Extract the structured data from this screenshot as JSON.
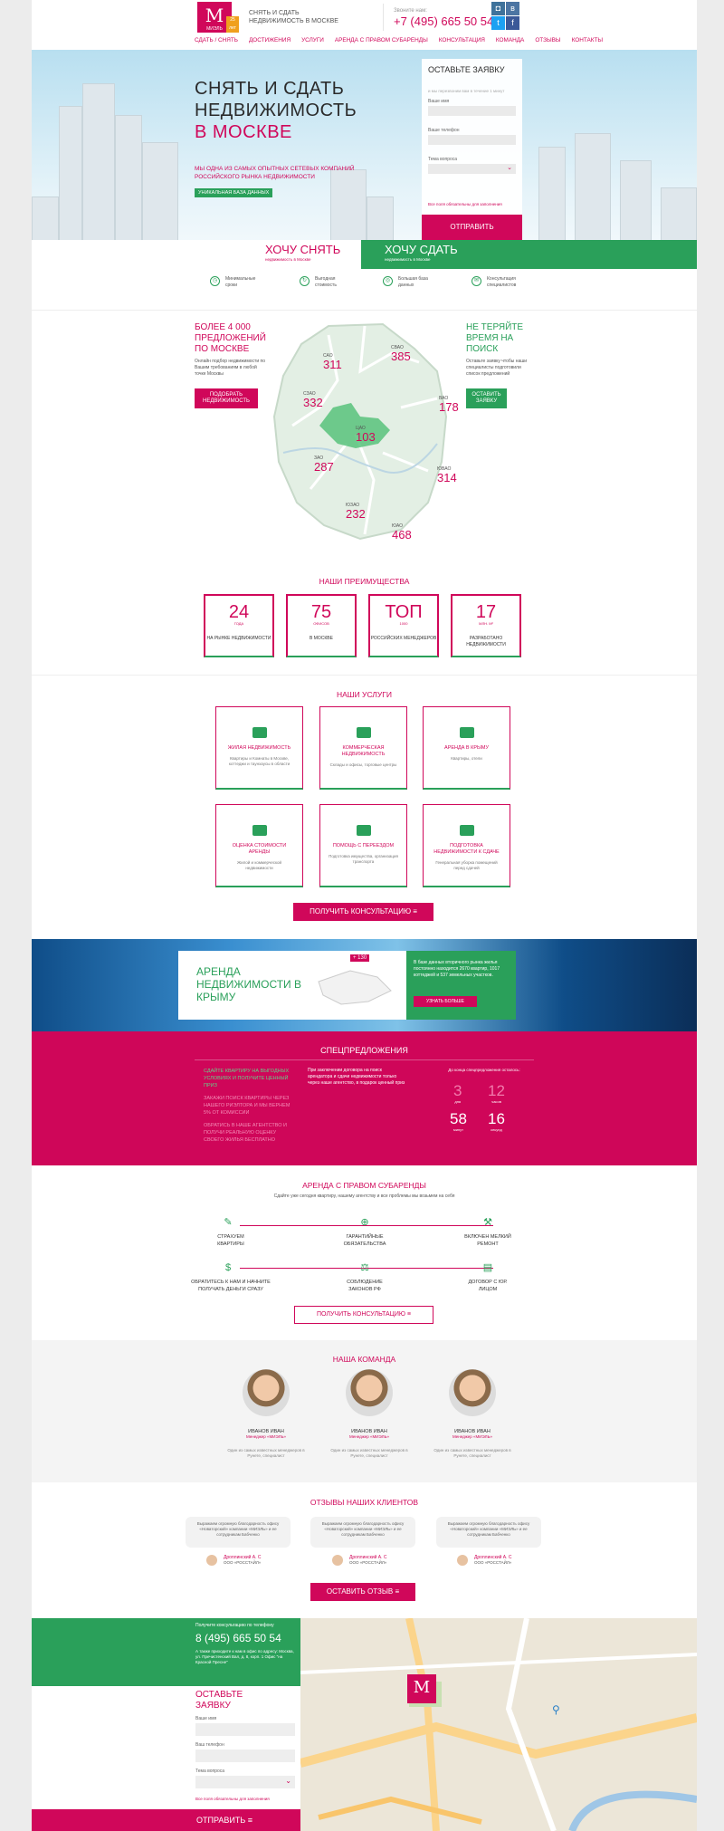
{
  "header": {
    "tagline": "СНЯТЬ И СДАТЬ НЕДВИЖИМОСТЬ В МОСКВЕ",
    "phone_label": "Звоните нам:",
    "phone": "+7 (495) 665 50 54",
    "logo_letter": "M",
    "logo_text": "МИЭЛЬ",
    "badge": "25 лет"
  },
  "nav": [
    "СДАТЬ / СНЯТЬ",
    "ДОСТИЖЕНИЯ",
    "УСЛУГИ",
    "АРЕНДА С ПРАВОМ СУБАРЕНДЫ",
    "КОНСУЛЬТАЦИЯ",
    "КОМАНДА",
    "ОТЗЫВЫ",
    "КОНТАКТЫ"
  ],
  "hero": {
    "title_1": "СНЯТЬ И СДАТЬ",
    "title_2": "НЕДВИЖИМОСТЬ",
    "title_3": "В МОСКВЕ",
    "sub": "МЫ ОДНА ИЗ САМЫХ ОПЫТНЫХ СЕТЕВЫХ КОМПАНИЙ РОССИЙСКОГО РЫНКА НЕДВИЖИМОСТИ",
    "badge": "УНИКАЛЬНАЯ БАЗА ДАННЫХ"
  },
  "form": {
    "title": "ОСТАВЬТЕ ЗАЯВКУ",
    "sub": "и мы перезвоним вам в течение 1 минут",
    "name": "Ваше имя",
    "phone": "Ваше телефон",
    "topic": "Тема вопроса",
    "note": "Все поля обязательны для заполнения",
    "button": "ОТПРАВИТЬ"
  },
  "tabs": {
    "rent": "ХОЧУ СНЯТЬ",
    "rent_sub": "недвижимость в Москве",
    "let": "ХОЧУ СДАТЬ",
    "let_sub": "недвижимость в Москве"
  },
  "features": [
    "Минимальные сроки",
    "Выгодная стоимость",
    "Большая база данных",
    "Консультация специалистов"
  ],
  "offers": {
    "title": "БОЛЕЕ 4 000 ПРЕДЛОЖЕНИЙ ПО МОСКВЕ",
    "text": "Онлайн подбор недвижимости по Вашим требованиям в любой точке Москвы",
    "button": "Подобрать НЕДВИЖИМОСТЬ"
  },
  "request": {
    "title": "НЕ ТЕРЯЙТЕ ВРЕМЯ НА ПОИСК",
    "text": "Оставьте заявку чтобы наши специалисты подготовили список предложений",
    "button": "Оставить ЗАЯВКУ"
  },
  "districts": [
    {
      "n": "САО",
      "v": "311"
    },
    {
      "n": "СВАО",
      "v": "385"
    },
    {
      "n": "СЗАО",
      "v": "332"
    },
    {
      "n": "ВАО",
      "v": "178"
    },
    {
      "n": "ЦАО",
      "v": "103"
    },
    {
      "n": "ЗАО",
      "v": "287"
    },
    {
      "n": "ЮВАО",
      "v": "314"
    },
    {
      "n": "ЮЗАО",
      "v": "232"
    },
    {
      "n": "ЮАО",
      "v": "468"
    }
  ],
  "advantages": {
    "title": "НАШИ ПРЕИМУЩЕСТВА",
    "items": [
      {
        "v": "24",
        "u": "ГОДА",
        "l": "НА РЫНКЕ НЕДВИЖИМОСТИ"
      },
      {
        "v": "75",
        "u": "ОФИСОВ",
        "l": "В МОСКВЕ"
      },
      {
        "v": "ТОП",
        "u": "1000",
        "l": "РОССИЙСКИХ МЕНЕДЖЕРОВ"
      },
      {
        "v": "17",
        "u": "МЛН. М²",
        "l": "РАЗРАБОТАНО НЕДВИЖИМОСТИ"
      }
    ]
  },
  "services": {
    "title": "НАШИ УСЛУГИ",
    "items": [
      {
        "t": "ЖИЛАЯ НЕДВИЖИМОСТЬ",
        "d": "Квартиры и Комнаты в Москве, коттеджи и таунхаусы в области"
      },
      {
        "t": "КОММЕРЧЕСКАЯ НЕДВИЖИМОСТЬ",
        "d": "Склады и офисы, торговые центры"
      },
      {
        "t": "АРЕНДА В КРЫМУ",
        "d": "Квартиры, отели"
      },
      {
        "t": "ОЦЕНКА СТОИМОСТИ АРЕНДЫ",
        "d": "Жилой и коммерческой недвижимости"
      },
      {
        "t": "ПОМОЩЬ С ПЕРЕЕЗДОМ",
        "d": "Подготовка имущества, организация транспорта"
      },
      {
        "t": "ПОДГОТОВКА НЕДВИЖИМОСТИ К СДАЧЕ",
        "d": "Генеральная уборка помещений перед сдачей"
      }
    ],
    "button": "ПОЛУЧИТЬ КОНСУЛЬТАЦИЮ"
  },
  "crimea": {
    "title": "АРЕНДА НЕДВИЖИМОСТИ В КРЫМУ",
    "badge": "+ 130",
    "text": "В базе данных вторичного рынка жилья постоянно находится 2670 квартир, 1017 коттеджей и 537 земельных участков.",
    "button": "УЗНАТЬ БОЛЬШЕ"
  },
  "special": {
    "title": "СПЕЦПРЕДЛОЖЕНИЯ",
    "items": [
      "СДАЙТЕ КВАРТИРУ НА ВЫГОДНЫХ УСЛОВИЯХ И ПОЛУЧИТЕ ЦЕННЫЙ ПРИЗ",
      "ЗАКАЖИ ПОИСК КВАРТИРЫ ЧЕРЕЗ НАШЕГО РИЭЛТОРА И МЫ ВЕРНЕМ 5% ОТ КОМИССИИ",
      "ОБРАТИСЬ В НАШЕ АГЕНТСТВО И ПОЛУЧИ РЕАЛЬНУЮ ОЦЕНКУ СВОЕГО ЖИЛЬЯ БЕСПЛАТНО"
    ],
    "text": "При заключении договора на поиск арендатора и сдачи недвижимости только через наше агентство, в подарок ценный приз",
    "timer_label": "До конца спецпредложения осталось:",
    "days": "3",
    "hours": "12",
    "minutes": "58",
    "seconds": "16",
    "u_days": "дня",
    "u_hours": "часов",
    "u_min": "минут",
    "u_sec": "секунд"
  },
  "sublease": {
    "title": "АРЕНДА С ПРАВОМ СУБАРЕНДЫ",
    "sub": "Сдайте уже сегодня квартиру, нашему агентству и все проблемы мы возьмем на себя",
    "items": [
      "СТРАХУЕМ КВАРТИРЫ",
      "ГАРАНТИЙНЫЕ ОБЯЗАТЕЛЬСТВА",
      "ВКЛЮЧЕН МЕЛКИЙ РЕМОНТ",
      "ОБРАТИТЕСЬ К НАМ И НАЧНИТЕ ПОЛУЧАТЬ ДЕНЬГИ СРАЗУ",
      "СОБЛЮДЕНИЕ ЗАКОНОВ РФ",
      "ДОГОВОР С ЮР. ЛИЦОМ"
    ],
    "button": "ПОЛУЧИТЬ КОНСУЛЬТАЦИЮ"
  },
  "team": {
    "title": "НАША КОМАНДА",
    "members": [
      {
        "n": "ИВАНОВ ИВАН",
        "r": "Менеджер «МИЭЛЬ»",
        "d": "Один из самых известных менеджеров в Рунете, специалист"
      },
      {
        "n": "ИВАНОВ ИВАН",
        "r": "Менеджер «МИЭЛЬ»",
        "d": "Один из самых известных менеджеров в Рунете, специалист"
      },
      {
        "n": "ИВАНОВ ИВАН",
        "r": "Менеджер «МИЭЛЬ»",
        "d": "Один из самых известных менеджеров в Рунете, специалист"
      }
    ]
  },
  "reviews": {
    "title": "ОТЗЫВЫ НАШИХ КЛИЕНТОВ",
    "items": [
      {
        "t": "Выражаем огромную благодарность офису «Новаторский» компании «МИЭЛЬ» и ее сотрудникам Бабченко",
        "a": "Дроплинский А. С",
        "c": "ООО «РОССТАЙЛ»"
      },
      {
        "t": "Выражаем огромную благодарность офису «Новаторский» компании «МИЭЛЬ» и ее сотрудникам Бабченко",
        "a": "Дроплинский А. С",
        "c": "ООО «РОССТАЙЛ»"
      },
      {
        "t": "Выражаем огромную благодарность офису «Новаторский» компании «МИЭЛЬ» и ее сотрудникам Бабченко",
        "a": "Дроплинский А. С",
        "c": "ООО «РОССТАЙЛ»"
      }
    ],
    "button": "ОСТАВИТЬ ОТЗЫВ"
  },
  "footer": {
    "label": "Получите консультацию по телефону",
    "phone": "8 (495) 665 50 54",
    "addr": "А также приходите к нам в офис по адресу: Москва, ул. Пречистенский Вал, д. 8, корп. 1 Офис \"на Красной Пресне\"",
    "form_title": "ОСТАВЬТЕ ЗАЯВКУ",
    "name": "Ваше имя",
    "phone_f": "Ваш телефон",
    "topic": "Тема вопроса",
    "note": "Все поля обязательны для заполнения",
    "button": "ОТПРАВИТЬ"
  },
  "colors": {
    "brand": "#d0075a",
    "accent": "#2aa05a"
  }
}
